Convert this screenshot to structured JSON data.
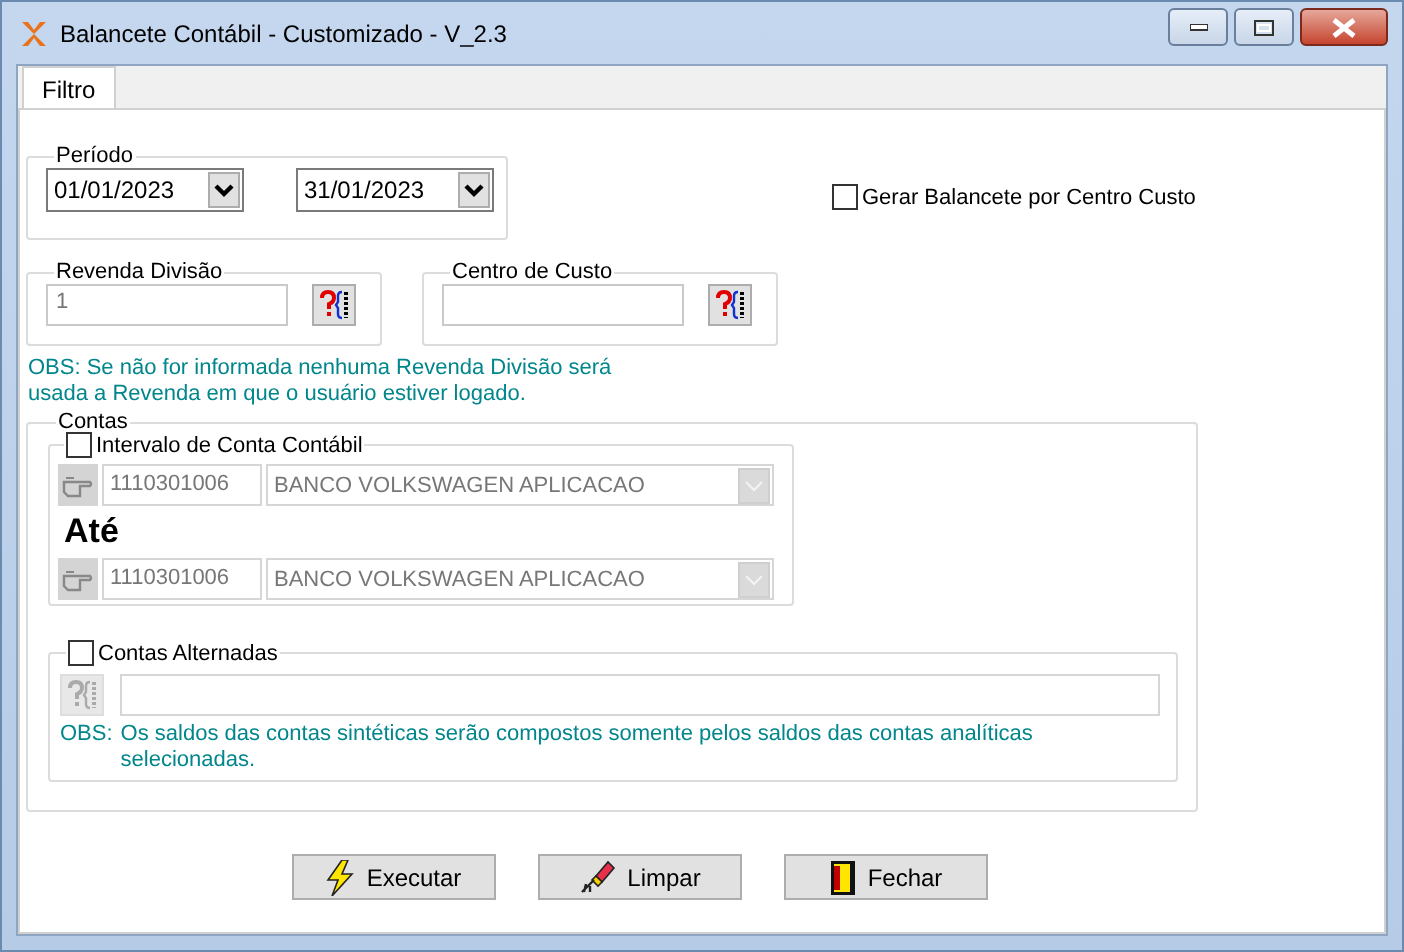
{
  "window": {
    "title": "Balancete Contábil - Customizado - V_2.3"
  },
  "tabs": [
    {
      "label": "Filtro",
      "selected": true
    }
  ],
  "periodo": {
    "label": "Período",
    "start": "01/01/2023",
    "end": "31/01/2023"
  },
  "gerar_por_centro_custo": {
    "label": "Gerar Balancete por Centro Custo",
    "checked": false
  },
  "revenda_divisao": {
    "label": "Revenda Divisão",
    "value": "1"
  },
  "centro_de_custo": {
    "label": "Centro de Custo"
  },
  "obs_revenda": "OBS: Se não for informada nenhuma Revenda Divisão será usada a Revenda em que o usuário estiver logado.",
  "contas": {
    "label": "Contas",
    "intervalo": {
      "label": "Intervalo de Conta Contábil",
      "checked": false,
      "disabled": true,
      "from": {
        "code": "1110301006",
        "name": "BANCO VOLKSWAGEN APLICACAO"
      },
      "separator": "Até",
      "to": {
        "code": "1110301006",
        "name": "BANCO VOLKSWAGEN APLICACAO"
      }
    },
    "alternadas": {
      "label": "Contas Alternadas",
      "checked": false,
      "disabled": true,
      "obs_label": "OBS:",
      "obs_text": "Os saldos das contas sintéticas serão compostos somente pelos saldos das contas analíticas selecionadas."
    }
  },
  "buttons": [
    {
      "label": "Executar",
      "kind": "execute"
    },
    {
      "label": "Limpar",
      "kind": "clear"
    },
    {
      "label": "Fechar",
      "kind": "close"
    }
  ]
}
